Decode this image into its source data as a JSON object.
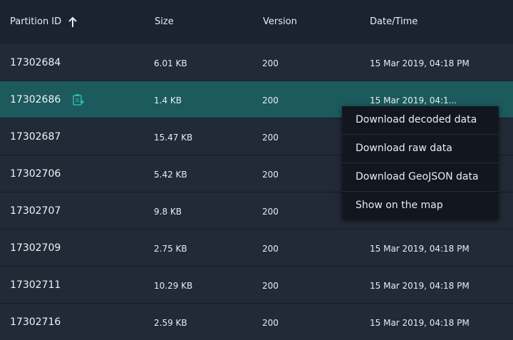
{
  "columns": {
    "partition_id": "Partition ID",
    "size": "Size",
    "version": "Version",
    "date_time": "Date/Time"
  },
  "sort": {
    "column": "Partition ID",
    "direction": "ascending",
    "icon": "arrow-up-icon"
  },
  "rows": [
    {
      "id": "17302684",
      "size": "6.01 KB",
      "version": "200",
      "date": "15 Mar 2019, 04:18 PM"
    },
    {
      "id": "17302686",
      "size": "1.4 KB",
      "version": "200",
      "date": "15 Mar 2019, 04:1...",
      "selected": true,
      "icon": "copy-icon"
    },
    {
      "id": "17302687",
      "size": "15.47 KB",
      "version": "200",
      "date": ""
    },
    {
      "id": "17302706",
      "size": "5.42 KB",
      "version": "200",
      "date": ""
    },
    {
      "id": "17302707",
      "size": "9.8 KB",
      "version": "200",
      "date": ""
    },
    {
      "id": "17302709",
      "size": "2.75 KB",
      "version": "200",
      "date": "15 Mar 2019, 04:18 PM"
    },
    {
      "id": "17302711",
      "size": "10.29 KB",
      "version": "200",
      "date": "15 Mar 2019, 04:18 PM"
    },
    {
      "id": "17302716",
      "size": "2.59 KB",
      "version": "200",
      "date": "15 Mar 2019, 04:18 PM"
    }
  ],
  "context_menu": {
    "items": [
      "Download decoded data",
      "Download raw data",
      "Download GeoJSON data",
      "Show on the map"
    ]
  },
  "colors": {
    "background": "#1e2532",
    "header": "#1b2230",
    "selected_row": "#1c5a5e",
    "menu": "#12171f",
    "accent": "#2fb8ac"
  }
}
